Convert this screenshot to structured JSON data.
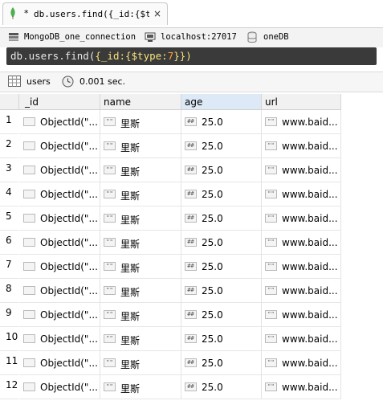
{
  "tab": {
    "star": "*",
    "title": "db.users.find({_id:{$ty…",
    "close": "×"
  },
  "connection": {
    "name": "MongoDB_one_connection",
    "server": "localhost:27017",
    "database": "oneDB"
  },
  "query": {
    "head": "db.users.find(",
    "open": "{",
    "key": "_id:",
    "inner": "{$type:",
    "num": "7",
    "close": "}})"
  },
  "status": {
    "collection": "users",
    "time": "0.001 sec."
  },
  "columns": [
    "_id",
    "name",
    "age",
    "url"
  ],
  "type_icons": {
    "object": "",
    "string": "\"\"",
    "number": "##"
  },
  "rows": [
    {
      "n": "1",
      "id": "ObjectId(\"...",
      "name": "里斯",
      "age": "25.0",
      "url": "www.baid..."
    },
    {
      "n": "2",
      "id": "ObjectId(\"...",
      "name": "里斯",
      "age": "25.0",
      "url": "www.baid..."
    },
    {
      "n": "3",
      "id": "ObjectId(\"...",
      "name": "里斯",
      "age": "25.0",
      "url": "www.baid..."
    },
    {
      "n": "4",
      "id": "ObjectId(\"...",
      "name": "里斯",
      "age": "25.0",
      "url": "www.baid..."
    },
    {
      "n": "5",
      "id": "ObjectId(\"...",
      "name": "里斯",
      "age": "25.0",
      "url": "www.baid..."
    },
    {
      "n": "6",
      "id": "ObjectId(\"...",
      "name": "里斯",
      "age": "25.0",
      "url": "www.baid..."
    },
    {
      "n": "7",
      "id": "ObjectId(\"...",
      "name": "里斯",
      "age": "25.0",
      "url": "www.baid..."
    },
    {
      "n": "8",
      "id": "ObjectId(\"...",
      "name": "里斯",
      "age": "25.0",
      "url": "www.baid..."
    },
    {
      "n": "9",
      "id": "ObjectId(\"...",
      "name": "里斯",
      "age": "25.0",
      "url": "www.baid..."
    },
    {
      "n": "10",
      "id": "ObjectId(\"...",
      "name": "里斯",
      "age": "25.0",
      "url": "www.baid..."
    },
    {
      "n": "11",
      "id": "ObjectId(\"...",
      "name": "里斯",
      "age": "25.0",
      "url": "www.baid..."
    },
    {
      "n": "12",
      "id": "ObjectId(\"...",
      "name": "里斯",
      "age": "25.0",
      "url": "www.baid..."
    }
  ]
}
